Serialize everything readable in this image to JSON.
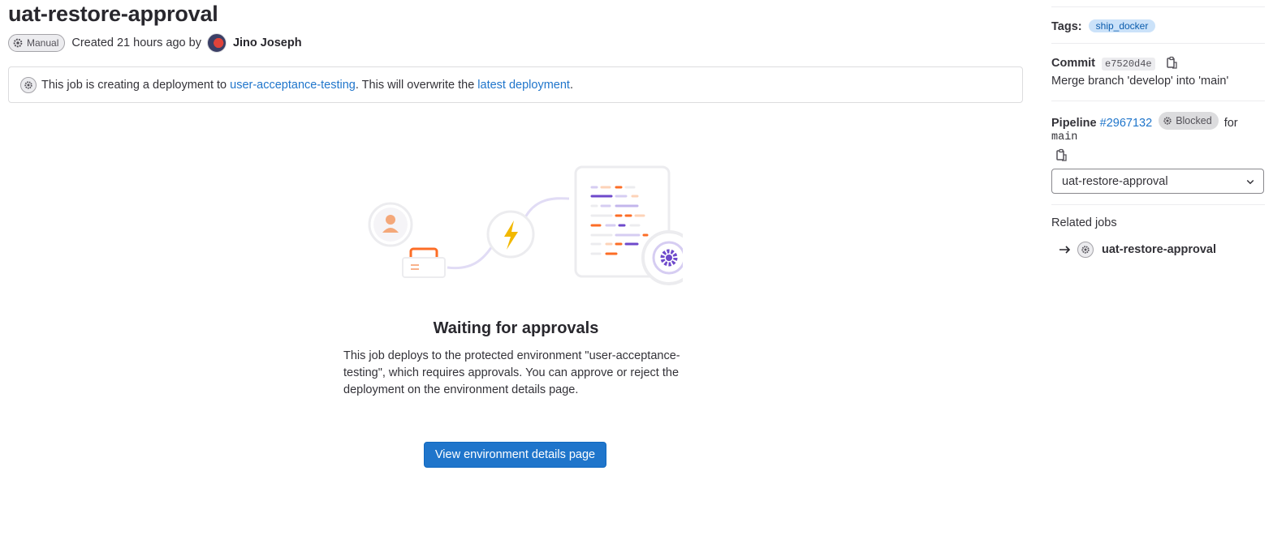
{
  "job": {
    "title": "uat-restore-approval",
    "status_badge": "Manual",
    "created_text": "Created 21 hours ago by",
    "user_name": "Jino Joseph"
  },
  "alert": {
    "prefix": "This job is creating a deployment to ",
    "environment_link": "user-acceptance-testing",
    "middle": ". This will overwrite the ",
    "latest_link": "latest deployment",
    "suffix": "."
  },
  "empty_state": {
    "title": "Waiting for approvals",
    "description": "This job deploys to the protected environment \"user-acceptance-testing\", which requires approvals. You can approve or reject the deployment on the environment details page.",
    "button_label": "View environment details page"
  },
  "sidebar": {
    "tags_label": "Tags:",
    "tag": "ship_docker",
    "commit_label": "Commit",
    "commit_sha": "e7520d4e",
    "commit_message": "Merge branch 'develop' into 'main'",
    "pipeline_label": "Pipeline",
    "pipeline_id": "#2967132",
    "pipeline_status": "Blocked",
    "for_text": "for",
    "ref": "main",
    "stage_select": "uat-restore-approval",
    "related_jobs_label": "Related jobs",
    "related_job": "uat-restore-approval"
  },
  "icons": [
    "gear-icon",
    "copy-icon",
    "chevron-down-icon",
    "arrow-right-icon",
    "lightning-icon",
    "user-icon"
  ],
  "colors": {
    "link": "#1f75cb",
    "primary_button": "#1f75cb",
    "tag_bg": "#cbe2f9",
    "illustration_orange": "#fc6d26",
    "illustration_purple": "#6e49cb",
    "illustration_yellow": "#f2b800"
  }
}
